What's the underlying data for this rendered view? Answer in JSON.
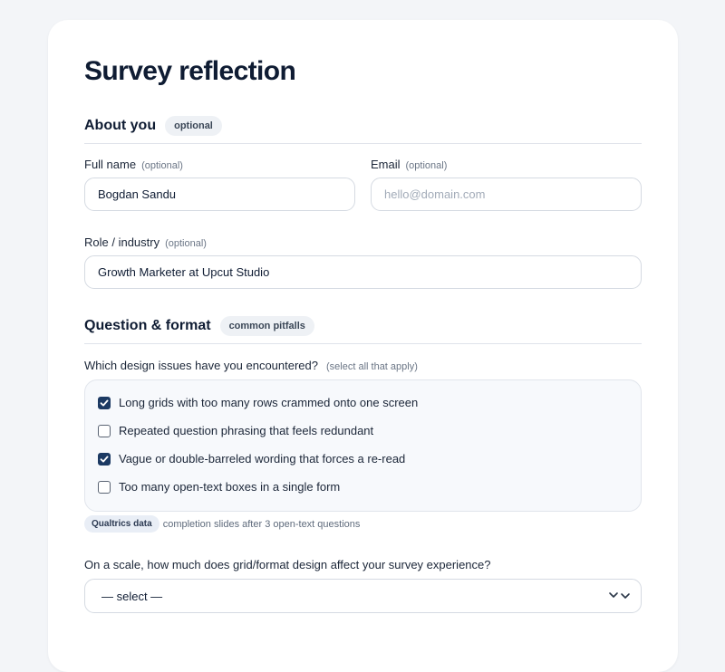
{
  "form": {
    "title": "Survey reflection"
  },
  "about": {
    "heading": "About you",
    "badge": "optional",
    "full_name": {
      "label": "Full name",
      "hint": "(optional)",
      "value": "Bogdan Sandu"
    },
    "email": {
      "label": "Email",
      "hint": "(optional)",
      "value": "",
      "placeholder": "hello@domain.com"
    },
    "role": {
      "label": "Role / industry",
      "hint": "(optional)",
      "value": "Growth Marketer at Upcut Studio"
    }
  },
  "question": {
    "heading": "Question & format",
    "badge": "common pitfalls",
    "issues_prompt": "Which design issues have you encountered?",
    "issues_hint": "(select all that apply)",
    "options": [
      {
        "label": "Long grids with too many rows crammed onto one screen",
        "checked": true
      },
      {
        "label": "Repeated question phrasing that feels redundant",
        "checked": false
      },
      {
        "label": "Vague or double-barreled wording that forces a re-read",
        "checked": true
      },
      {
        "label": "Too many open-text boxes in a single form",
        "checked": false
      }
    ],
    "source_badge": "Qualtrics data",
    "source_note": "completion slides after 3 open-text questions",
    "scale_prompt": "On a scale, how much does grid/format design affect your survey experience?",
    "scale_value": "— select —"
  },
  "colors": {
    "accent": "#1c3a63",
    "background": "#f3f5f8",
    "card": "#ffffff"
  },
  "icons": {
    "checkbox_mark": "check-icon",
    "select_indicator": "chevron-up-down-icon"
  }
}
